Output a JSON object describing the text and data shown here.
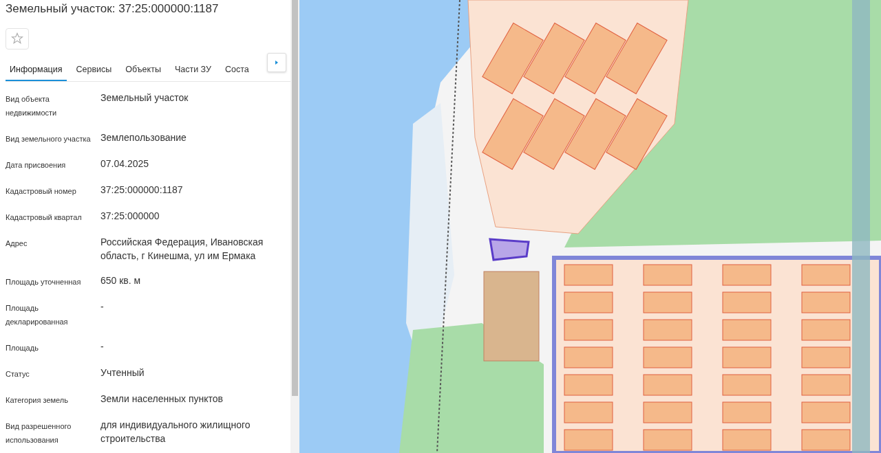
{
  "title": "Земельный участок: 37:25:000000:1187",
  "favorite": false,
  "tabs": [
    {
      "label": "Информация",
      "selected": true
    },
    {
      "label": "Сервисы",
      "selected": false
    },
    {
      "label": "Объекты",
      "selected": false
    },
    {
      "label": "Части ЗУ",
      "selected": false
    },
    {
      "label": "Соста",
      "selected": false
    }
  ],
  "fields": [
    {
      "label": "Вид объекта недвижимости",
      "value": "Земельный участок"
    },
    {
      "label": "Вид земельного участка",
      "value": "Землепользование"
    },
    {
      "label": "Дата присвоения",
      "value": "07.04.2025"
    },
    {
      "label": "Кадастровый номер",
      "value": "37:25:000000:1187"
    },
    {
      "label": "Кадастровый квартал",
      "value": "37:25:000000"
    },
    {
      "label": "Адрес",
      "value": "Российская Федерация, Ивановская область, г Кинешма, ул им Ермака"
    },
    {
      "label": "Площадь уточненная",
      "value": "650 кв. м"
    },
    {
      "label": "Площадь декларированная",
      "value": "-"
    },
    {
      "label": "Площадь",
      "value": "-"
    },
    {
      "label": "Статус",
      "value": "Учтенный"
    },
    {
      "label": "Категория земель",
      "value": "Земли населенных пунктов"
    },
    {
      "label": "Вид разрешенного использования",
      "value": "для индивидуального жилищного строительства"
    }
  ]
}
